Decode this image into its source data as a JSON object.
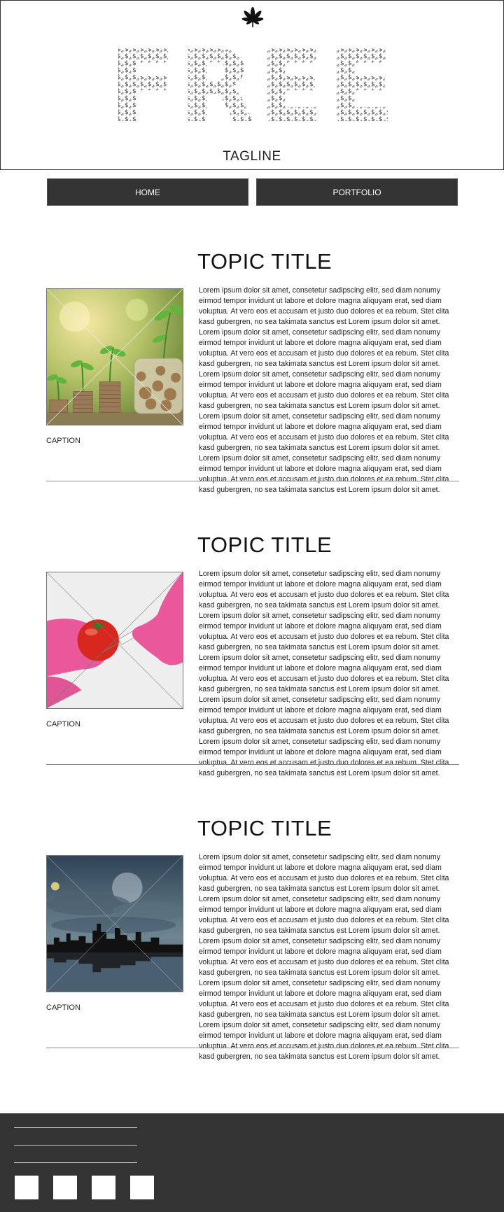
{
  "header": {
    "logo_icon": "cannabis-leaf-icon",
    "brand_word": "FREE",
    "brand_glyph": "$",
    "tagline": "TAGLINE"
  },
  "nav": {
    "items": [
      {
        "label": "HOME"
      },
      {
        "label": "PORTFOLIO"
      }
    ]
  },
  "sections": [
    {
      "title": "TOPIC TITLE",
      "image": "money-plant-coins-photo",
      "caption": "CAPTION",
      "paragraphs": [
        "Lorem ipsum dolor sit amet, consetetur sadipscing elitr, sed diam nonumy eirmod tempor invidunt ut labore et dolore magna aliquyam erat, sed diam voluptua. At vero eos et accusam et justo duo dolores et ea rebum. Stet clita kasd gubergren, no sea takimata sanctus est Lorem ipsum dolor sit amet.",
        "Lorem ipsum dolor sit amet, consetetur sadipscing elitr, sed diam nonumy eirmod tempor invidunt ut labore et dolore magna aliquyam erat, sed diam voluptua. At vero eos et accusam et justo duo dolores et ea rebum. Stet clita kasd gubergren, no sea takimata sanctus est Lorem ipsum dolor sit amet.",
        "Lorem ipsum dolor sit amet, consetetur sadipscing elitr, sed diam nonumy eirmod tempor invidunt ut labore et dolore magna aliquyam erat, sed diam voluptua. At vero eos et accusam et justo duo dolores et ea rebum. Stet clita kasd gubergren, no sea takimata sanctus est Lorem ipsum dolor sit amet.",
        "Lorem ipsum dolor sit amet, consetetur sadipscing elitr, sed diam nonumy eirmod tempor invidunt ut labore et dolore magna aliquyam erat, sed diam voluptua. At vero eos et accusam et justo duo dolores et ea rebum. Stet clita kasd gubergren, no sea takimata sanctus est Lorem ipsum dolor sit amet.",
        "Lorem ipsum dolor sit amet, consetetur sadipscing elitr, sed diam nonumy eirmod tempor invidunt ut labore et dolore magna aliquyam erat, sed diam voluptua. At vero eos et accusam et justo duo dolores et ea rebum. Stet clita kasd gubergren, no sea takimata sanctus est Lorem ipsum dolor sit amet."
      ]
    },
    {
      "title": "TOPIC TITLE",
      "image": "tomato-syringe-photo",
      "caption": "CAPTION",
      "paragraphs": [
        "Lorem ipsum dolor sit amet, consetetur sadipscing elitr, sed diam nonumy eirmod tempor invidunt ut labore et dolore magna aliquyam erat, sed diam voluptua. At vero eos et accusam et justo duo dolores et ea rebum. Stet clita kasd gubergren, no sea takimata sanctus est Lorem ipsum dolor sit amet.",
        "Lorem ipsum dolor sit amet, consetetur sadipscing elitr, sed diam nonumy eirmod tempor invidunt ut labore et dolore magna aliquyam erat, sed diam voluptua. At vero eos et accusam et justo duo dolores et ea rebum. Stet clita kasd gubergren, no sea takimata sanctus est Lorem ipsum dolor sit amet.",
        "Lorem ipsum dolor sit amet, consetetur sadipscing elitr, sed diam nonumy eirmod tempor invidunt ut labore et dolore magna aliquyam erat, sed diam voluptua. At vero eos et accusam et justo duo dolores et ea rebum. Stet clita kasd gubergren, no sea takimata sanctus est Lorem ipsum dolor sit amet.",
        "Lorem ipsum dolor sit amet, consetetur sadipscing elitr, sed diam nonumy eirmod tempor invidunt ut labore et dolore magna aliquyam erat, sed diam voluptua. At vero eos et accusam et justo duo dolores et ea rebum. Stet clita kasd gubergren, no sea takimata sanctus est Lorem ipsum dolor sit amet.",
        "Lorem ipsum dolor sit amet, consetetur sadipscing elitr, sed diam nonumy eirmod tempor invidunt ut labore et dolore magna aliquyam erat, sed diam voluptua. At vero eos et accusam et justo duo dolores et ea rebum. Stet clita kasd gubergren, no sea takimata sanctus est Lorem ipsum dolor sit amet."
      ]
    },
    {
      "title": "TOPIC TITLE",
      "image": "city-skyline-storm-photo",
      "caption": "CAPTION",
      "paragraphs": [
        "Lorem ipsum dolor sit amet, consetetur sadipscing elitr, sed diam nonumy eirmod tempor invidunt ut labore et dolore magna aliquyam erat, sed diam voluptua. At vero eos et accusam et justo duo dolores et ea rebum. Stet clita kasd gubergren, no sea takimata sanctus est Lorem ipsum dolor sit amet.",
        "Lorem ipsum dolor sit amet, consetetur sadipscing elitr, sed diam nonumy eirmod tempor invidunt ut labore et dolore magna aliquyam erat, sed diam voluptua. At vero eos et accusam et justo duo dolores et ea rebum. Stet clita kasd gubergren, no sea takimata sanctus est Lorem ipsum dolor sit amet.",
        "Lorem ipsum dolor sit amet, consetetur sadipscing elitr, sed diam nonumy eirmod tempor invidunt ut labore et dolore magna aliquyam erat, sed diam voluptua. At vero eos et accusam et justo duo dolores et ea rebum. Stet clita kasd gubergren, no sea takimata sanctus est Lorem ipsum dolor sit amet.",
        "Lorem ipsum dolor sit amet, consetetur sadipscing elitr, sed diam nonumy eirmod tempor invidunt ut labore et dolore magna aliquyam erat, sed diam voluptua. At vero eos et accusam et justo duo dolores et ea rebum. Stet clita kasd gubergren, no sea takimata sanctus est Lorem ipsum dolor sit amet.",
        "Lorem ipsum dolor sit amet, consetetur sadipscing elitr, sed diam nonumy eirmod tempor invidunt ut labore et dolore magna aliquyam erat, sed diam voluptua. At vero eos et accusam et justo duo dolores et ea rebum. Stet clita kasd gubergren, no sea takimata sanctus est Lorem ipsum dolor sit amet."
      ]
    }
  ],
  "footer": {
    "background": "#333333",
    "social_icons": [
      "social-icon-1",
      "social-icon-2",
      "social-icon-3",
      "social-icon-4"
    ]
  },
  "colors": {
    "dark": "#333333",
    "nav_text": "#ffffff",
    "divider": "#8a8a8a"
  }
}
